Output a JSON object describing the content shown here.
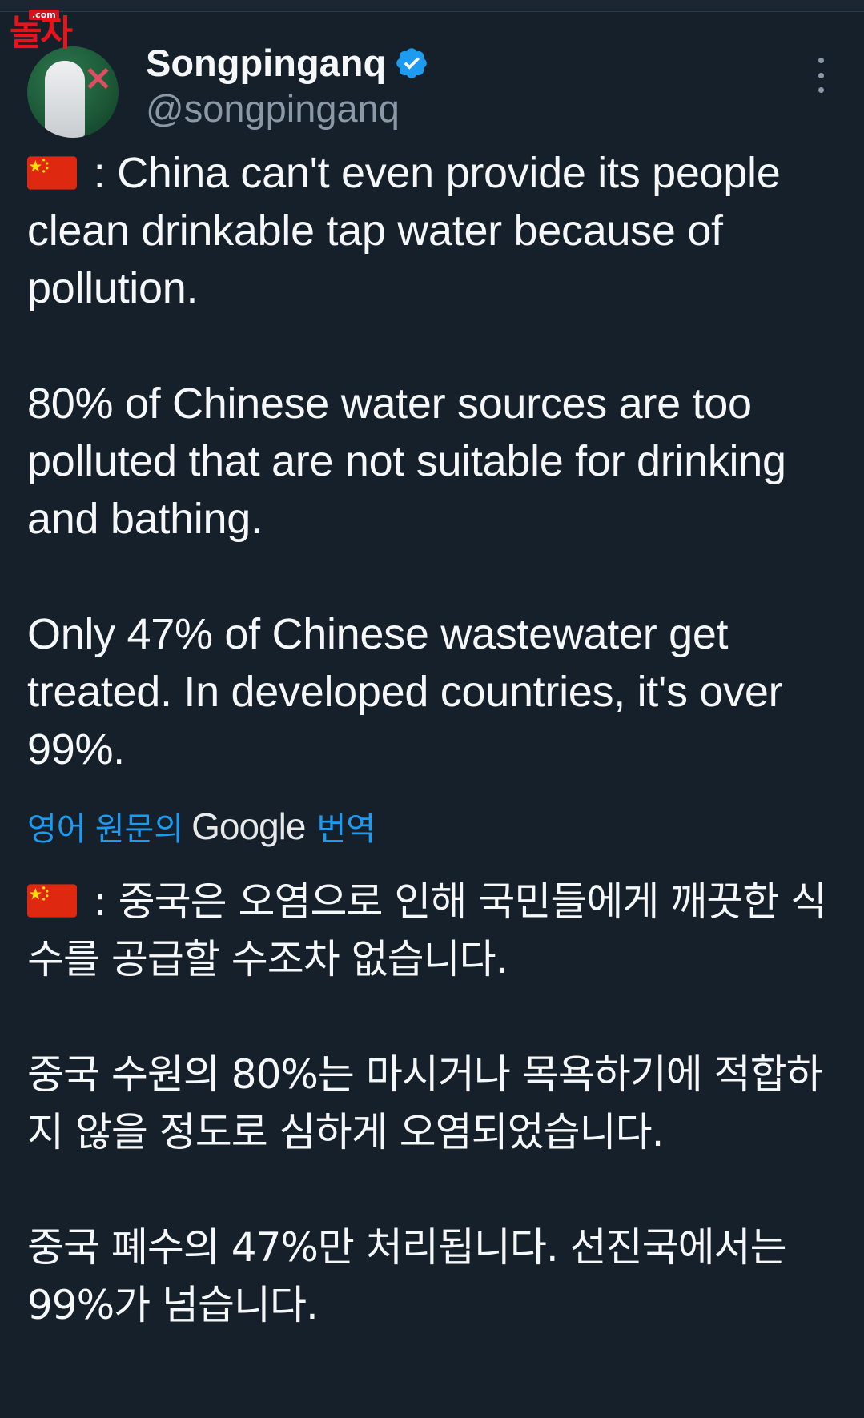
{
  "watermark": {
    "text": "놀자",
    "suffix": ".com"
  },
  "author": {
    "display_name": "Songpinganq",
    "handle": "@songpinganq",
    "verified": true,
    "avatar_icon": "avatar-hazmat-icon"
  },
  "colors": {
    "background": "#15202b",
    "text": "#f5f7f8",
    "secondary": "#8b98a5",
    "link": "#1d9bf0",
    "verified": "#1d9bf0"
  },
  "tweet": {
    "flag_icon": "china-flag-icon",
    "paragraphs": [
      " : China can't even provide its people clean drinkable tap water because of pollution.",
      "80% of Chinese water sources are too polluted that are not suitable for drinking and bathing.",
      "Only 47% of Chinese wastewater get treated. In developed countries, it's over 99%."
    ]
  },
  "translation": {
    "prefix": "영어 원문의",
    "provider": "Google",
    "suffix": "번역",
    "paragraphs": [
      " : 중국은 오염으로 인해 국민들에게 깨끗한 식수를 공급할 수조차 없습니다.",
      "중국 수원의 80%는 마시거나 목욕하기에 적합하지 않을 정도로 심하게 오염되었습니다.",
      "중국 폐수의 47%만 처리됩니다. 선진국에서는 99%가 넘습니다."
    ]
  }
}
